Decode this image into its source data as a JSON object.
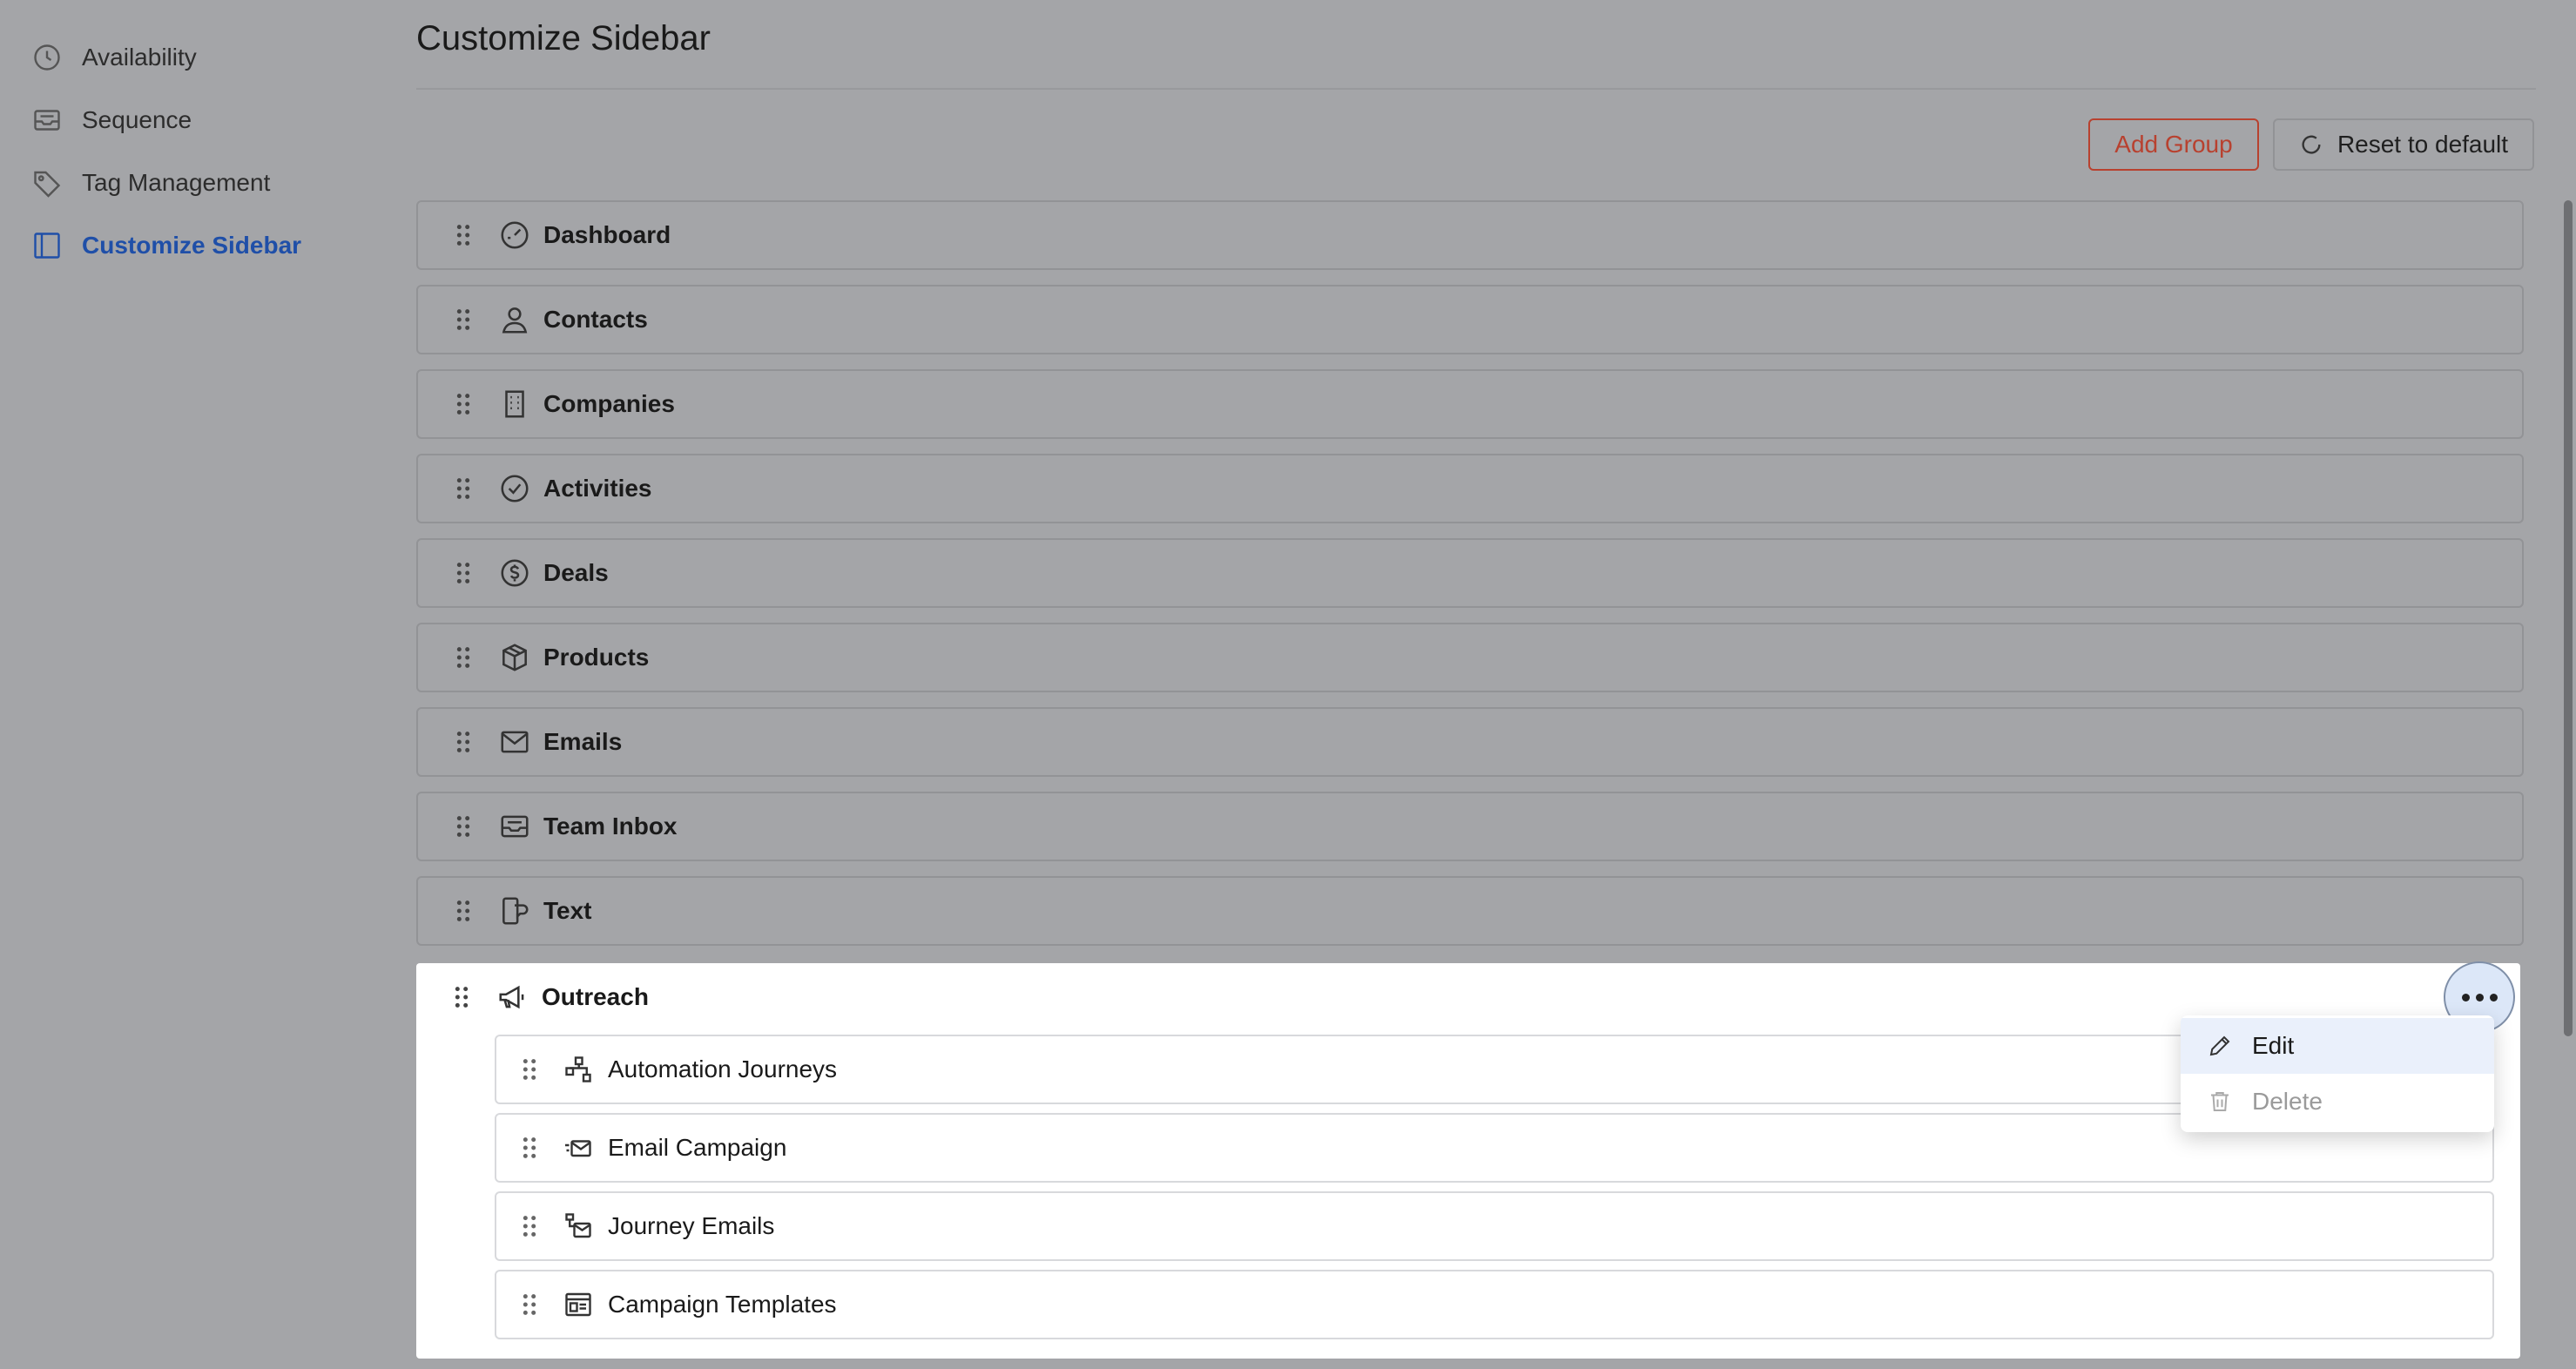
{
  "nav": {
    "items": [
      {
        "label": "Availability",
        "icon": "clock-icon"
      },
      {
        "label": "Sequence",
        "icon": "tray-icon"
      },
      {
        "label": "Tag Management",
        "icon": "tag-icon"
      },
      {
        "label": "Customize Sidebar",
        "icon": "sidebar-icon",
        "active": true
      }
    ]
  },
  "page": {
    "title": "Customize Sidebar",
    "add_group_label": "Add Group",
    "reset_label": "Reset to default"
  },
  "groups": [
    {
      "label": "Dashboard",
      "icon": "gauge-icon"
    },
    {
      "label": "Contacts",
      "icon": "person-icon"
    },
    {
      "label": "Companies",
      "icon": "building-icon"
    },
    {
      "label": "Activities",
      "icon": "check-circle-icon"
    },
    {
      "label": "Deals",
      "icon": "dollar-circle-icon"
    },
    {
      "label": "Products",
      "icon": "box-icon"
    },
    {
      "label": "Emails",
      "icon": "envelope-icon"
    },
    {
      "label": "Team Inbox",
      "icon": "inbox-icon"
    },
    {
      "label": "Text",
      "icon": "phone-chat-icon"
    }
  ],
  "outreach": {
    "label": "Outreach",
    "icon": "megaphone-icon",
    "children": [
      {
        "label": "Automation Journeys",
        "icon": "flow-icon"
      },
      {
        "label": "Email Campaign",
        "icon": "send-mail-icon"
      },
      {
        "label": "Journey Emails",
        "icon": "journey-mail-icon"
      },
      {
        "label": "Campaign Templates",
        "icon": "template-icon"
      }
    ]
  },
  "menu": {
    "edit_label": "Edit",
    "delete_label": "Delete"
  },
  "colors": {
    "accent": "#1f4fa8",
    "danger": "#b8412f",
    "overlay": "#a4a5a8"
  }
}
